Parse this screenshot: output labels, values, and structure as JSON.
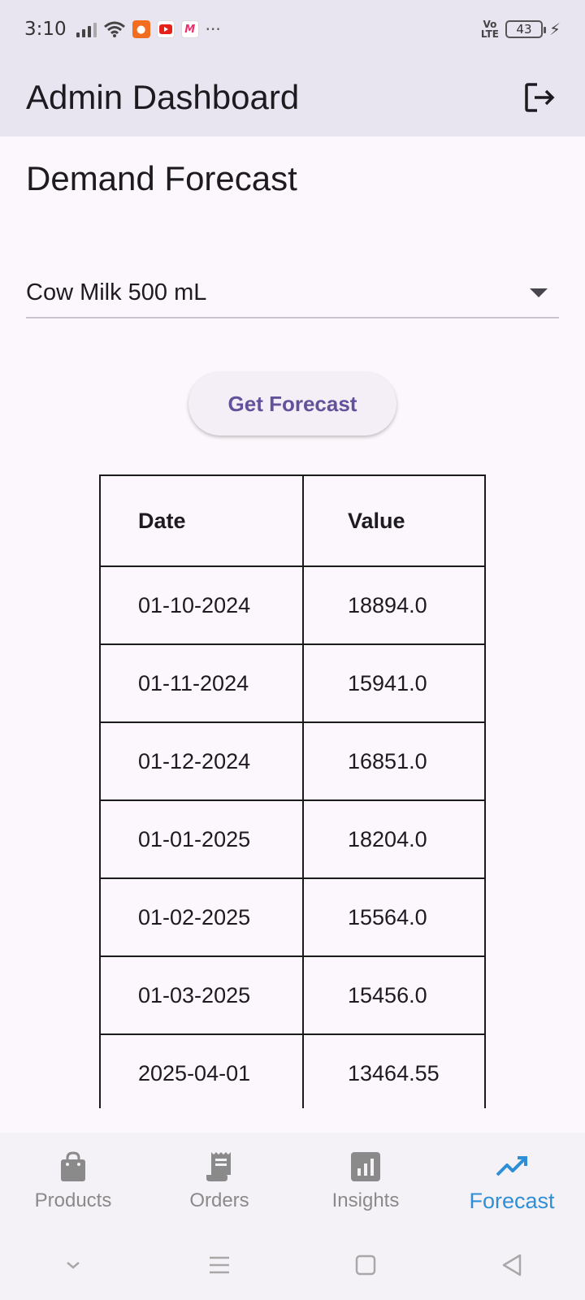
{
  "status_bar": {
    "time": "3:10",
    "volte_top": "Vo",
    "volte_bottom": "LTE",
    "battery": "43",
    "more": "···"
  },
  "app_bar": {
    "title": "Admin Dashboard",
    "logout_icon": "logout-icon"
  },
  "page": {
    "heading": "Demand Forecast"
  },
  "product_select": {
    "value": "Cow Milk 500 mL"
  },
  "forecast_button": {
    "label": "Get Forecast"
  },
  "table": {
    "headers": [
      "Date",
      "Value"
    ],
    "rows": [
      [
        "01-10-2024",
        "18894.0"
      ],
      [
        "01-11-2024",
        "15941.0"
      ],
      [
        "01-12-2024",
        "16851.0"
      ],
      [
        "01-01-2025",
        "18204.0"
      ],
      [
        "01-02-2025",
        "15564.0"
      ],
      [
        "01-03-2025",
        "15456.0"
      ],
      [
        "2025-04-01",
        "13464.55"
      ]
    ]
  },
  "bottom_nav": {
    "items": [
      {
        "label": "Products",
        "icon": "shopping-bag-icon"
      },
      {
        "label": "Orders",
        "icon": "receipt-icon"
      },
      {
        "label": "Insights",
        "icon": "bar-chart-icon"
      },
      {
        "label": "Forecast",
        "icon": "trending-up-icon",
        "active": true
      }
    ],
    "active_color": "#2e8fd6"
  },
  "colors": {
    "app_bar_bg": "#e8e4f0",
    "body_bg": "#fcf7fc",
    "button_text": "#63519b"
  }
}
